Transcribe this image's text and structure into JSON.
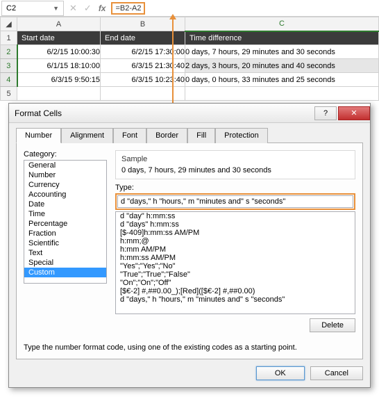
{
  "formula_bar": {
    "cell_ref": "C2",
    "formula": "=B2-A2"
  },
  "columns": {
    "rowhead": "",
    "A": "A",
    "B": "B",
    "C": "C"
  },
  "headers": {
    "A": "Start date",
    "B": "End date",
    "C": "Time difference"
  },
  "rows": [
    {
      "n": "2",
      "A": "6/2/15 10:00:30",
      "B": "6/2/15 17:30:00",
      "C": "0 days, 7 hours, 29 minutes and 30 seconds"
    },
    {
      "n": "3",
      "A": "6/1/15 18:10:00",
      "B": "6/3/15 21:30:40",
      "C": "2 days, 3 hours, 20 minutes and 40 seconds"
    },
    {
      "n": "4",
      "A": "6/3/15 9:50:15",
      "B": "6/3/15 10:23:40",
      "C": "0 days, 0 hours, 33 minutes and 25 seconds"
    }
  ],
  "dialog": {
    "title": "Format Cells",
    "help_icon": "?",
    "close_icon": "✕",
    "tabs": [
      "Number",
      "Alignment",
      "Font",
      "Border",
      "Fill",
      "Protection"
    ],
    "active_tab": 0,
    "category_label": "Category:",
    "categories": [
      "General",
      "Number",
      "Currency",
      "Accounting",
      "Date",
      "Time",
      "Percentage",
      "Fraction",
      "Scientific",
      "Text",
      "Special",
      "Custom"
    ],
    "selected_category": 11,
    "sample_label": "Sample",
    "sample_value": "0 days, 7 hours, 29 minutes and 30 seconds",
    "type_label": "Type:",
    "type_value": "d \"days,\" h \"hours,\" m \"minutes and\" s \"seconds\"",
    "type_list": [
      "d \"day\" h:mm:ss",
      "d \"days\" h:mm:ss",
      "[$-409]h:mm:ss AM/PM",
      "h:mm;@",
      " h:mm AM/PM",
      "h:mm:ss AM/PM",
      "\"Yes\";\"Yes\";\"No\"",
      "\"True\";\"True\";\"False\"",
      "\"On\";\"On\";\"Off\"",
      "[$€-2] #,##0.00_);[Red]([$€-2] #,##0.00)",
      "d \"days,\" h \"hours,\" m \"minutes and\" s \"seconds\""
    ],
    "delete_label": "Delete",
    "hint": "Type the number format code, using one of the existing codes as a starting point.",
    "ok": "OK",
    "cancel": "Cancel"
  }
}
